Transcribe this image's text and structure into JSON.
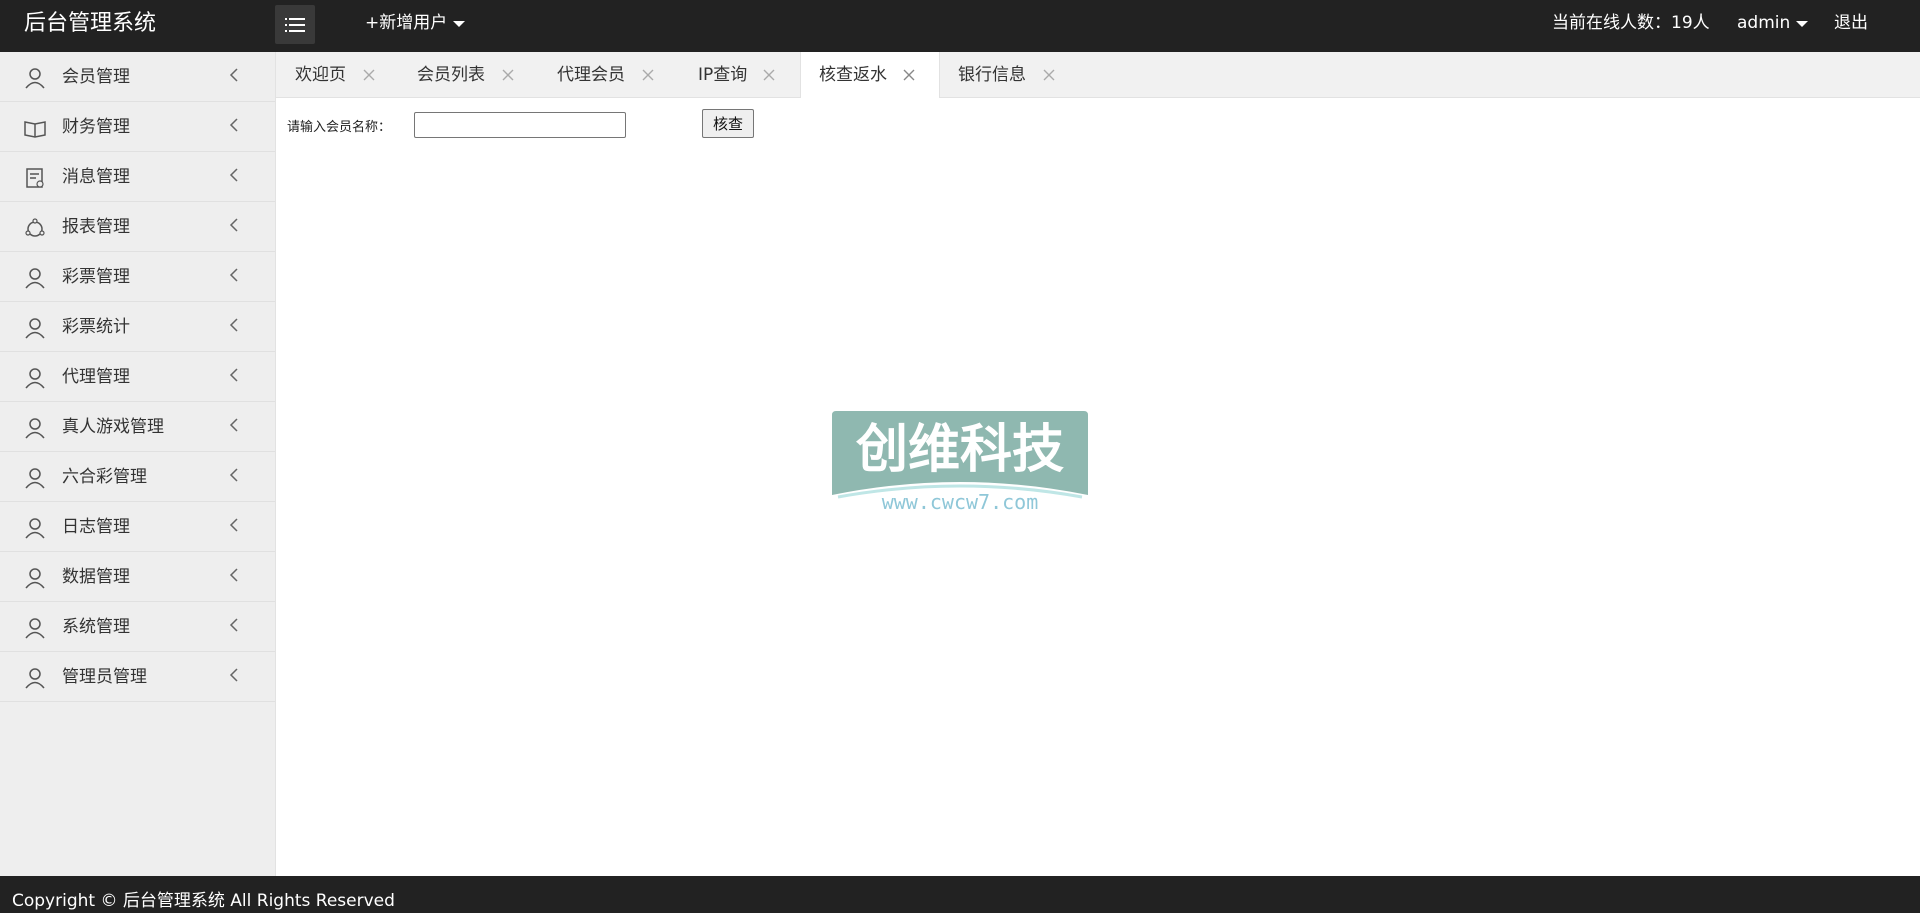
{
  "header": {
    "logo": "后台管理系统",
    "add_user": "+新增用户",
    "online": "当前在线人数：19人",
    "admin": "admin",
    "logout": "退出"
  },
  "sidebar": {
    "items": [
      {
        "label": "会员管理",
        "icon": "user-icon"
      },
      {
        "label": "财务管理",
        "icon": "book-icon"
      },
      {
        "label": "消息管理",
        "icon": "message-icon"
      },
      {
        "label": "报表管理",
        "icon": "report-icon"
      },
      {
        "label": "彩票管理",
        "icon": "user-icon"
      },
      {
        "label": "彩票统计",
        "icon": "user-icon"
      },
      {
        "label": "代理管理",
        "icon": "user-icon"
      },
      {
        "label": "真人游戏管理",
        "icon": "user-icon"
      },
      {
        "label": "六合彩管理",
        "icon": "user-icon"
      },
      {
        "label": "日志管理",
        "icon": "user-icon"
      },
      {
        "label": "数据管理",
        "icon": "user-icon"
      },
      {
        "label": "系统管理",
        "icon": "user-icon"
      },
      {
        "label": "管理员管理",
        "icon": "user-icon"
      }
    ]
  },
  "tabs": [
    {
      "label": "欢迎页"
    },
    {
      "label": "会员列表"
    },
    {
      "label": "代理会员"
    },
    {
      "label": "IP查询"
    },
    {
      "label": "核查返水",
      "active": true
    },
    {
      "label": "银行信息"
    }
  ],
  "form": {
    "label": "请输入会员名称：",
    "input_value": "",
    "button": "核查"
  },
  "watermark": {
    "title": "创维科技",
    "url": "www.cwcw7.com"
  },
  "footer": {
    "copyright": "Copyright © 后台管理系统 All Rights Reserved"
  },
  "colors": {
    "header_bg": "#222222",
    "sidebar_bg": "#eeeeee",
    "watermark": "#8fb8b0"
  }
}
